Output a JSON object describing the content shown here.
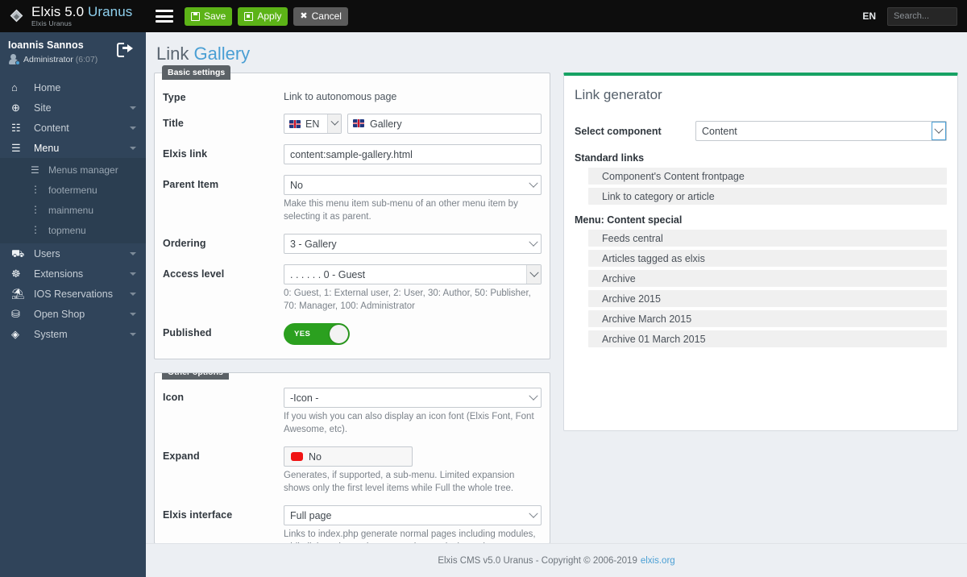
{
  "topbar": {
    "logo_icon": "diamond-icon",
    "brand_title_prefix": "Elxis 5.0 ",
    "brand_title_accent": "Uranus",
    "brand_subtitle": "Elxis Uranus",
    "menu_toggle_icon": "hamburger-icon",
    "save_label": "Save",
    "apply_label": "Apply",
    "cancel_label": "Cancel",
    "cancel_icon": "x-icon",
    "language_code": "EN",
    "search_placeholder": "Search..."
  },
  "sidebar": {
    "user_name": "Ioannis Sannos",
    "user_role": "Administrator",
    "user_session_time": "(6:07)",
    "logout_icon": "logout-icon",
    "items": [
      {
        "label": "Home",
        "icon": "home-icon",
        "glyph": "⌂",
        "caret": false,
        "active": false
      },
      {
        "label": "Site",
        "icon": "globe-icon",
        "glyph": "⊕",
        "caret": true,
        "active": false
      },
      {
        "label": "Content",
        "icon": "document-icon",
        "glyph": "☷",
        "caret": true,
        "active": false
      },
      {
        "label": "Menu",
        "icon": "menu-bars-icon",
        "glyph": "☰",
        "caret": true,
        "active": true
      },
      {
        "label": "Users",
        "icon": "users-icon",
        "glyph": "⛟",
        "caret": true,
        "active": false
      },
      {
        "label": "Extensions",
        "icon": "puzzle-icon",
        "glyph": "☸",
        "caret": true,
        "active": false
      },
      {
        "label": "IOS Reservations",
        "icon": "umbrella-icon",
        "glyph": "⛱",
        "caret": true,
        "active": false
      },
      {
        "label": "Open Shop",
        "icon": "cart-icon",
        "glyph": "⛁",
        "caret": true,
        "active": false
      },
      {
        "label": "System",
        "icon": "diamond-icon",
        "glyph": "◈",
        "caret": true,
        "active": false
      }
    ],
    "submenu": [
      {
        "label": "Menus manager",
        "icon": "menu-bars-icon",
        "glyph": "☰"
      },
      {
        "label": "footermenu",
        "icon": "vertical-dots-icon",
        "glyph": "⋮"
      },
      {
        "label": "mainmenu",
        "icon": "vertical-dots-icon",
        "glyph": "⋮"
      },
      {
        "label": "topmenu",
        "icon": "vertical-dots-icon",
        "glyph": "⋮"
      }
    ]
  },
  "page": {
    "title_prefix": "Link ",
    "title_accent": "Gallery"
  },
  "basic_settings": {
    "legend": "Basic settings",
    "type_label": "Type",
    "type_value": "Link to autonomous page",
    "title_label": "Title",
    "title_lang": "EN",
    "title_value": "Gallery",
    "elxis_link_label": "Elxis link",
    "elxis_link_value": "content:sample-gallery.html",
    "parent_item_label": "Parent Item",
    "parent_item_value": "No",
    "parent_item_hint": "Make this menu item sub-menu of an other menu item by selecting it as parent.",
    "ordering_label": "Ordering",
    "ordering_value": "3 - Gallery",
    "access_level_label": "Access level",
    "access_level_value": ". . . . . . 0 - Guest",
    "access_level_hint": "0: Guest, 1: External user, 2: User, 30: Author, 50: Publisher, 70: Manager, 100: Administrator",
    "published_label": "Published",
    "published_value": "YES"
  },
  "other_options": {
    "legend": "Other options",
    "icon_label": "Icon",
    "icon_value": "-Icon -",
    "icon_hint": "If you wish you can also display an icon font (Elxis Font, Font Awesome, etc).",
    "expand_label": "Expand",
    "expand_value": "No",
    "expand_hint": "Generates, if supported, a sub-menu. Limited expansion shows only the first level items while Full the whole tree.",
    "interface_label": "Elxis interface",
    "interface_value": "Full page",
    "interface_hint": "Links to index.php generate normal pages including modules, while links to inner.php pages where only the main component area is visible (useful for popup windows)."
  },
  "link_generator": {
    "title": "Link generator",
    "select_component_label": "Select component",
    "select_component_value": "Content",
    "standard_links_heading": "Standard links",
    "standard_links": [
      "Component's Content frontpage",
      "Link to category or article"
    ],
    "special_heading": "Menu: Content special",
    "special_links": [
      "Feeds central",
      "Articles tagged as elxis",
      "Archive",
      "Archive 2015",
      "Archive March 2015",
      "Archive 01 March 2015"
    ]
  },
  "footer": {
    "text": "Elxis CMS v5.0 Uranus - Copyright © 2006-2019",
    "link": "elxis.org"
  },
  "colors": {
    "topbar_bg": "#0d0d0d",
    "sidebar_bg": "#30445a",
    "submenu_bg": "#2b3e51",
    "accent_blue": "#4a9fd4",
    "green_button": "#5cb317",
    "card_top_border": "#16a263",
    "toggle_on": "#2ba01f",
    "red": "#f01313"
  }
}
